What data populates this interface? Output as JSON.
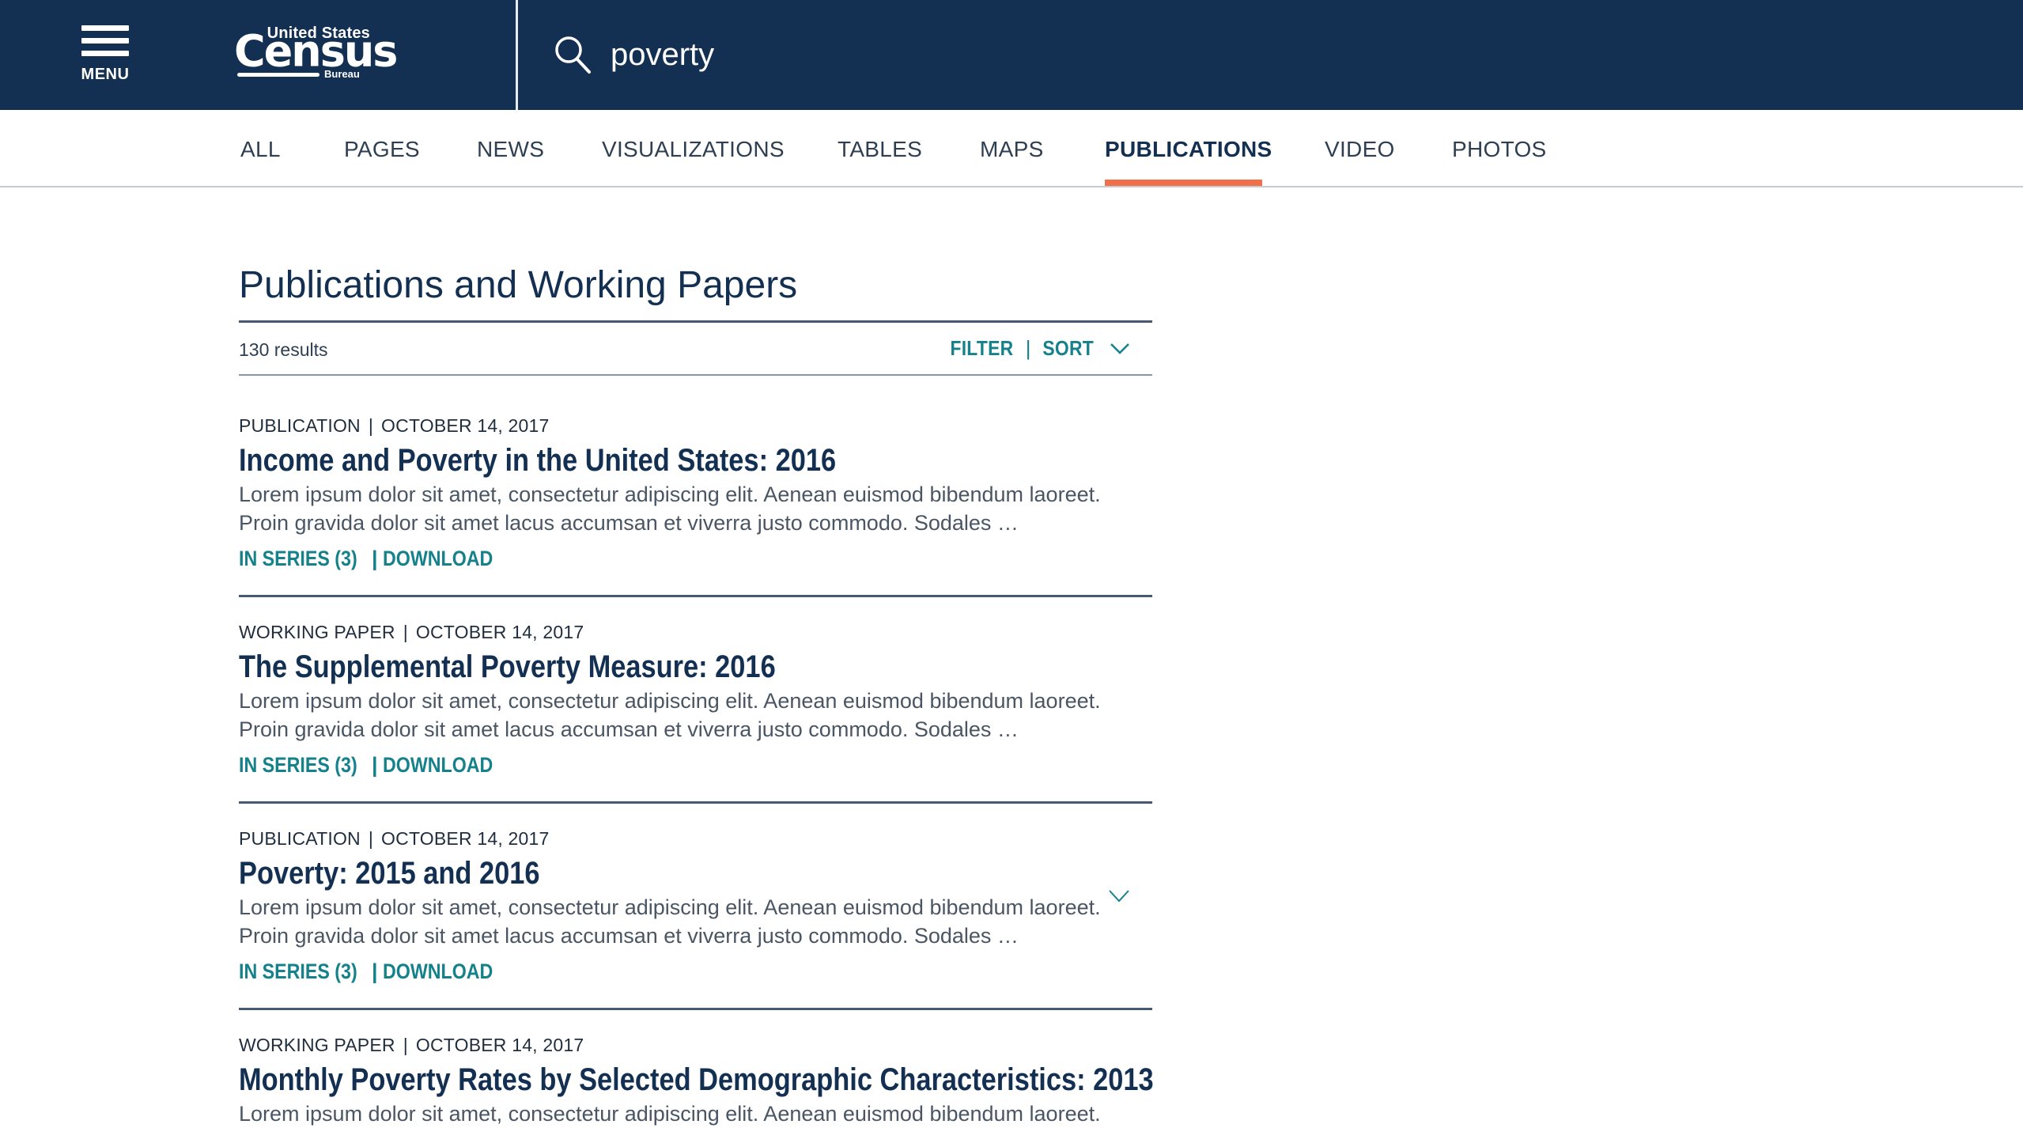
{
  "header": {
    "menu_label": "MENU",
    "logo": {
      "top": "United States",
      "main": "Census",
      "sub": "Bureau"
    },
    "search": {
      "value": "poverty",
      "placeholder": ""
    }
  },
  "colors": {
    "header_bg": "#132f51",
    "accent": "#f0704b",
    "link": "#14818b",
    "title": "#132f51"
  },
  "tabs": [
    {
      "label": "ALL",
      "active": false
    },
    {
      "label": "PAGES",
      "active": false
    },
    {
      "label": "NEWS",
      "active": false
    },
    {
      "label": "VISUALIZATIONS",
      "active": false
    },
    {
      "label": "TABLES",
      "active": false
    },
    {
      "label": "MAPS",
      "active": false
    },
    {
      "label": "PUBLICATIONS",
      "active": true
    },
    {
      "label": "VIDEO",
      "active": false
    },
    {
      "label": "PHOTOS",
      "active": false
    }
  ],
  "main": {
    "title": "Publications and Working Papers",
    "results_count": "130 results",
    "filter_label": "FILTER",
    "sort_label": "SORT",
    "separator": "|"
  },
  "results": [
    {
      "type": "PUBLICATION",
      "date": "OCTOBER 14, 2017",
      "title": "Income and Poverty in the United States: 2016",
      "desc1": "Lorem ipsum dolor sit amet, consectetur adipiscing elit. Aenean euismod bibendum laoreet.",
      "desc2": "Proin gravida dolor sit amet lacus accumsan et viverra justo commodo. Sodales …",
      "series": "IN SERIES (3)",
      "download": "DOWNLOAD"
    },
    {
      "type": "WORKING PAPER",
      "date": "OCTOBER 14, 2017",
      "title": "The Supplemental Poverty Measure: 2016",
      "desc1": "Lorem ipsum dolor sit amet, consectetur adipiscing elit. Aenean euismod bibendum laoreet.",
      "desc2": "Proin gravida dolor sit amet lacus accumsan et viverra justo commodo. Sodales …",
      "series": "IN SERIES (3)",
      "download": "DOWNLOAD"
    },
    {
      "type": "PUBLICATION",
      "date": "OCTOBER 14, 2017",
      "title": "Poverty: 2015 and 2016",
      "desc1": "Lorem ipsum dolor sit amet, consectetur adipiscing elit. Aenean euismod bibendum laoreet.",
      "desc2": "Proin gravida dolor sit amet lacus accumsan et viverra justo commodo. Sodales …",
      "series": "IN SERIES (3)",
      "download": "DOWNLOAD"
    },
    {
      "type": "WORKING PAPER",
      "date": "OCTOBER 14, 2017",
      "title": "Monthly Poverty Rates by Selected Demographic Characteristics: 2013",
      "desc1": "Lorem ipsum dolor sit amet, consectetur adipiscing elit. Aenean euismod bibendum laoreet."
    }
  ]
}
